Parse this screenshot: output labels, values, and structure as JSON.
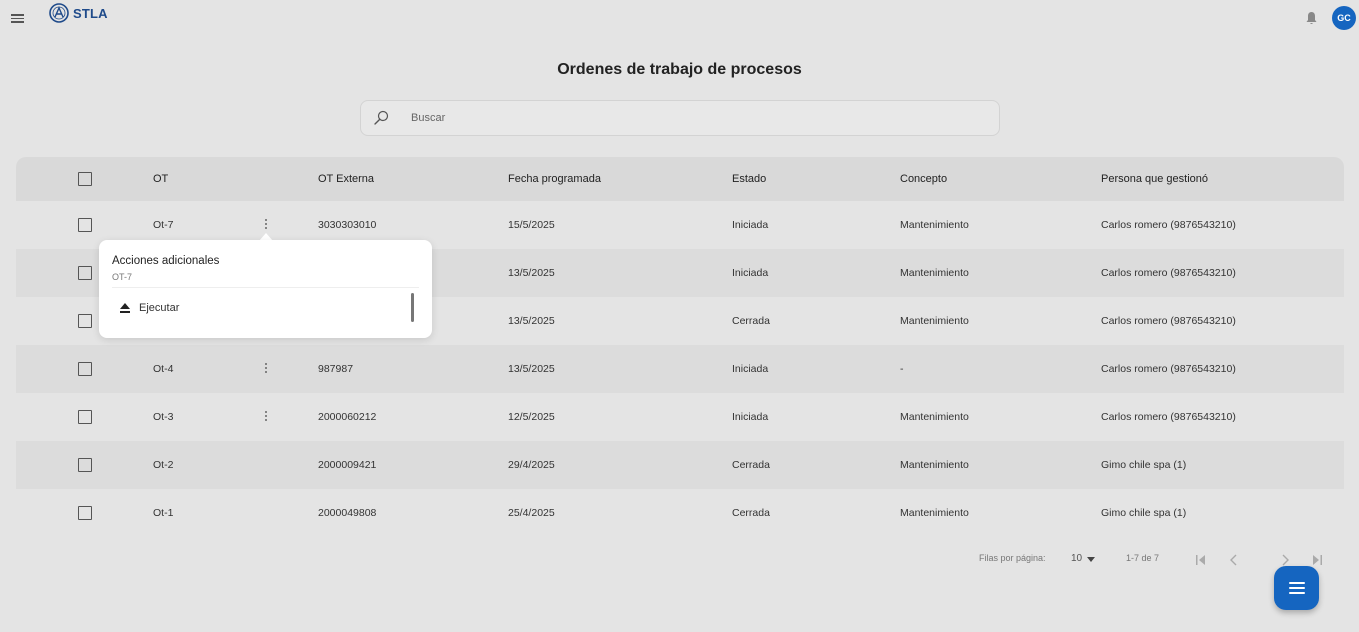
{
  "app": {
    "brand": "STLA",
    "avatar_initials": "GC"
  },
  "page": {
    "title": "Ordenes de trabajo de procesos"
  },
  "search": {
    "placeholder": "Buscar"
  },
  "table": {
    "headers": {
      "ot": "OT",
      "ot_externa": "OT Externa",
      "fecha": "Fecha programada",
      "estado": "Estado",
      "concepto": "Concepto",
      "persona": "Persona que gestionó"
    },
    "rows": [
      {
        "ot": "Ot-7",
        "ot_externa": "3030303010",
        "fecha": "15/5/2025",
        "estado": "Iniciada",
        "concepto": "Mantenimiento",
        "persona": "Carlos romero  (9876543210)"
      },
      {
        "ot": "",
        "ot_externa": "",
        "fecha": "13/5/2025",
        "estado": "Iniciada",
        "concepto": "Mantenimiento",
        "persona": "Carlos romero  (9876543210)"
      },
      {
        "ot": "",
        "ot_externa": "",
        "fecha": "13/5/2025",
        "estado": "Cerrada",
        "concepto": "Mantenimiento",
        "persona": "Carlos romero  (9876543210)"
      },
      {
        "ot": "Ot-4",
        "ot_externa": "987987",
        "fecha": "13/5/2025",
        "estado": "Iniciada",
        "concepto": "-",
        "persona": "Carlos romero  (9876543210)"
      },
      {
        "ot": "Ot-3",
        "ot_externa": "2000060212",
        "fecha": "12/5/2025",
        "estado": "Iniciada",
        "concepto": "Mantenimiento",
        "persona": "Carlos romero  (9876543210)"
      },
      {
        "ot": "Ot-2",
        "ot_externa": "2000009421",
        "fecha": "29/4/2025",
        "estado": "Cerrada",
        "concepto": "Mantenimiento",
        "persona": "Gimo chile spa (1)"
      },
      {
        "ot": "Ot-1",
        "ot_externa": "2000049808",
        "fecha": "25/4/2025",
        "estado": "Cerrada",
        "concepto": "Mantenimiento",
        "persona": "Gimo chile spa (1)"
      }
    ]
  },
  "popup": {
    "title": "Acciones adicionales",
    "subtitle": "OT-7",
    "action_label": "Ejecutar"
  },
  "pagination": {
    "rows_per_page_label": "Filas por página:",
    "rows_per_page_value": "10",
    "range": "1-7 de 7"
  },
  "colors": {
    "primary": "#1565c0",
    "brand_text": "#1e4a8a",
    "background": "#e4e4e4"
  }
}
